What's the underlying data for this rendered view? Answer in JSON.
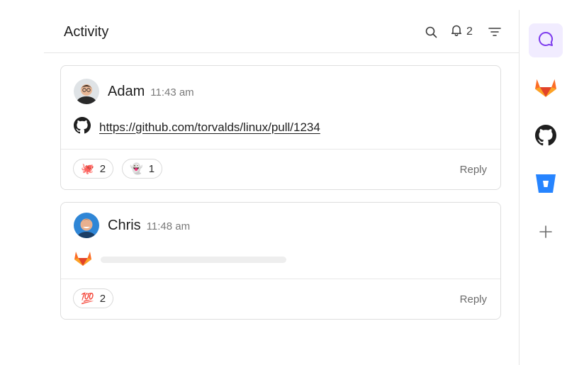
{
  "header": {
    "title": "Activity",
    "notification_count": "2"
  },
  "posts": [
    {
      "author": "Adam",
      "time": "11:43 am",
      "source_icon": "github-icon",
      "link": "https://github.com/torvalds/linux/pull/1234",
      "reactions": [
        {
          "emoji": "🐙",
          "count": "2"
        },
        {
          "emoji": "👻",
          "count": "1"
        }
      ],
      "reply_label": "Reply"
    },
    {
      "author": "Chris",
      "time": "11:48 am",
      "source_icon": "gitlab-icon",
      "link": "",
      "reactions": [
        {
          "emoji": "💯",
          "count": "2"
        }
      ],
      "reply_label": "Reply"
    }
  ],
  "sidebar": {
    "items": [
      {
        "icon": "chat-bubble-icon",
        "active": true
      },
      {
        "icon": "gitlab-icon",
        "active": false
      },
      {
        "icon": "github-icon",
        "active": false
      },
      {
        "icon": "bitbucket-icon",
        "active": false
      },
      {
        "icon": "plus-icon",
        "active": false
      }
    ]
  },
  "colors": {
    "accent": "#7c3aed",
    "active_bg": "#f1ecff",
    "gitlab_orange": "#fc6d26",
    "bitbucket_blue": "#2684ff"
  }
}
